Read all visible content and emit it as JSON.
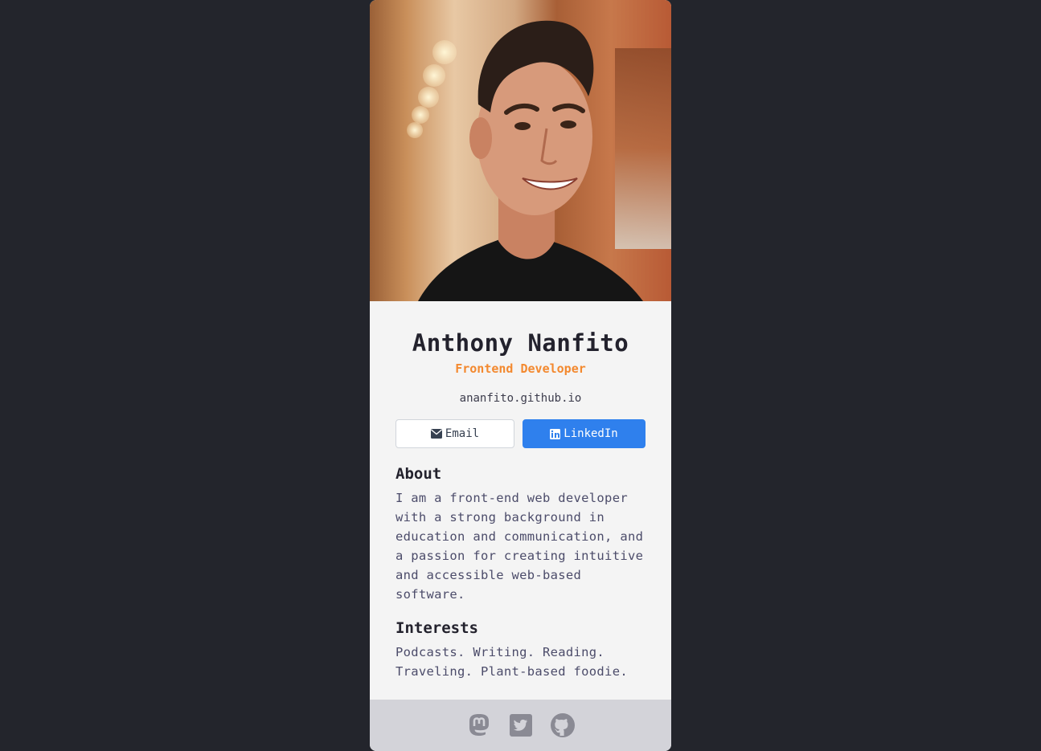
{
  "profile": {
    "name": "Anthony Nanfito",
    "role": "Frontend Developer",
    "website": "ananfito.github.io"
  },
  "buttons": {
    "email_label": "Email",
    "email_icon": "envelope-icon",
    "linkedin_label": "LinkedIn",
    "linkedin_icon": "linkedin-icon"
  },
  "about": {
    "heading": "About",
    "text": "I am a front-end web developer with a strong background in education and communication, and a passion for creating intuitive and accessible web-based software."
  },
  "interests": {
    "heading": "Interests",
    "text": "Podcasts. Writing. Reading. Traveling. Plant-based foodie."
  },
  "footer": {
    "icons": [
      "mastodon-icon",
      "twitter-icon",
      "github-icon"
    ]
  },
  "colors": {
    "background": "#23252c",
    "card": "#f4f4f4",
    "accent": "#f3892f",
    "linkedin": "#2f80ed",
    "footer": "#d3d3d9",
    "icon": "#8a8a94"
  }
}
